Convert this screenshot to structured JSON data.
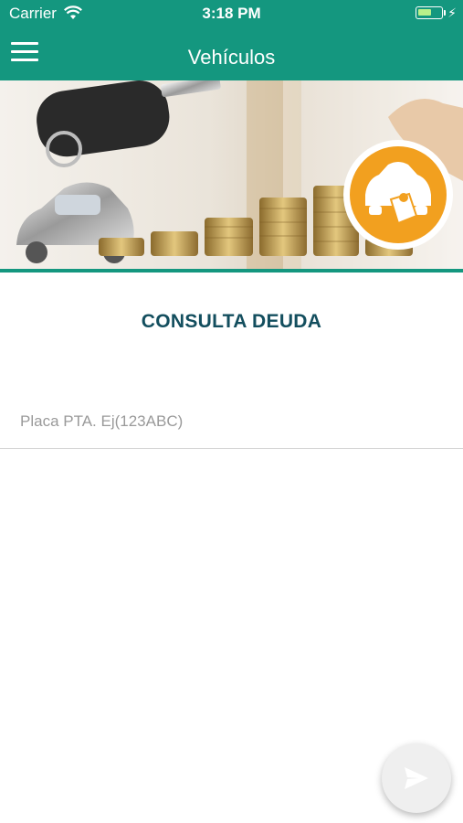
{
  "status_bar": {
    "carrier": "Carrier",
    "time": "3:18 PM",
    "battery_level": 0.6
  },
  "nav": {
    "title": "Vehículos",
    "menu_icon": "hamburger-menu-icon"
  },
  "banner": {
    "image": "car-keys-and-coin-stacks",
    "badge_icon": "car-payment-icon",
    "badge_color": "#f2a01f"
  },
  "form": {
    "title": "CONSULTA DEUDA",
    "plate_value": "",
    "plate_placeholder": "Placa PTA. Ej(123ABC)"
  },
  "fab": {
    "icon": "send-icon"
  },
  "colors": {
    "primary": "#14977f",
    "title_text": "#134e5e"
  }
}
